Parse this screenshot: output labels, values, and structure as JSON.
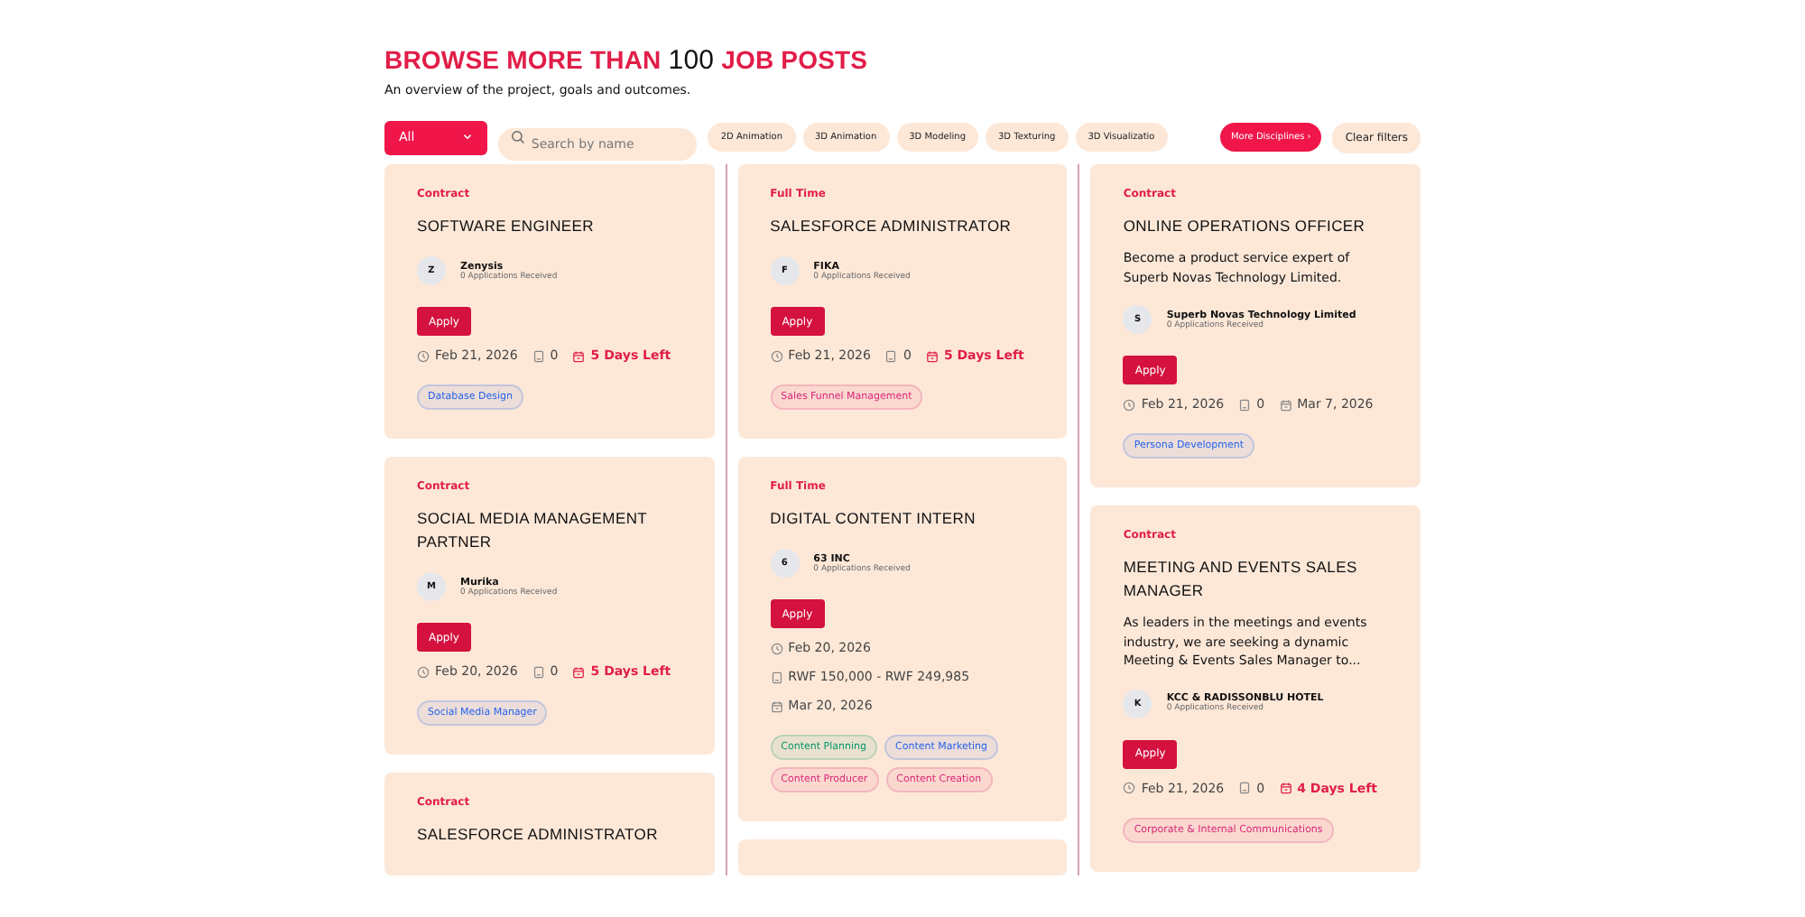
{
  "heading": {
    "lead": "BROWSE MORE THAN",
    "count": "100",
    "tail": "JOB POSTS"
  },
  "subtitle": "An overview of the project, goals and outcomes.",
  "filters": {
    "dropdown": "All",
    "search_placeholder": "Search by name",
    "chips": [
      {
        "label": "2D Animation"
      },
      {
        "label": "3D Animation"
      },
      {
        "label": "3D Modeling"
      },
      {
        "label": "3D Texturing"
      },
      {
        "label": "3D Visualizatio"
      }
    ],
    "more": "More Disciplines",
    "more_icon": "›",
    "clear": "Clear filters"
  },
  "columns": [
    [
      {
        "type": "Contract",
        "title": "SOFTWARE ENGINEER",
        "initial": "Z",
        "company": "Zenysis",
        "applications": "0 Applications Received",
        "apply": "Apply",
        "kind": "inline",
        "posted": "Feb 21, 2026",
        "count": "0",
        "deadline": "5 Days Left",
        "urgent": true,
        "tags": [
          {
            "label": "Database Design",
            "color": "#2563eb"
          }
        ]
      },
      {
        "type": "Contract",
        "title": "SOCIAL MEDIA MANAGEMENT PARTNER",
        "initial": "M",
        "company": "Murika",
        "applications": "0 Applications Received",
        "apply": "Apply",
        "kind": "inline",
        "posted": "Feb 20, 2026",
        "count": "0",
        "deadline": "5 Days Left",
        "urgent": true,
        "tags": [
          {
            "label": "Social Media Manager",
            "color": "#2563eb"
          }
        ]
      },
      {
        "type": "Contract",
        "title": "SALESFORCE ADMINISTRATOR",
        "kind": "cut"
      }
    ],
    [
      {
        "type": "Full Time",
        "title": "SALESFORCE ADMINISTRATOR",
        "initial": "F",
        "company": "FIKA",
        "applications": "0 Applications Received",
        "apply": "Apply",
        "kind": "inline",
        "posted": "Feb 21, 2026",
        "count": "0",
        "deadline": "5 Days Left",
        "urgent": true,
        "tags": [
          {
            "label": "Sales Funnel Management",
            "color": "#db2777"
          }
        ]
      },
      {
        "type": "Full Time",
        "title": "DIGITAL CONTENT INTERN",
        "initial": "6",
        "company": "63 INC",
        "applications": "0 Applications Received",
        "apply": "Apply",
        "kind": "stacked",
        "posted": "Feb 20, 2026",
        "salary": "RWF 150,000 - RWF 249,985",
        "deadline": "Mar 20, 2026",
        "urgent": false,
        "tags": [
          {
            "label": "Content Planning",
            "color": "#059669"
          },
          {
            "label": "Content Marketing",
            "color": "#2563eb"
          },
          {
            "label": "Content Producer",
            "color": "#db2777"
          },
          {
            "label": "Content Creation",
            "color": "#db2777"
          }
        ]
      },
      {
        "kind": "empty"
      }
    ],
    [
      {
        "type": "Contract",
        "title": "ONLINE OPERATIONS OFFICER",
        "description": "Become a product service expert of Superb Novas Technology Limited.",
        "initial": "S",
        "company": "Superb Novas Technology Limited",
        "applications": "0 Applications Received",
        "apply": "Apply",
        "kind": "inline",
        "posted": "Feb 21, 2026",
        "count": "0",
        "deadline": "Mar 7, 2026",
        "urgent": false,
        "tags": [
          {
            "label": "Persona Development",
            "color": "#2563eb"
          }
        ]
      },
      {
        "type": "Contract",
        "title": "MEETING AND EVENTS SALES MANAGER",
        "description": "As leaders in the meetings and events industry, we are seeking a dynamic Meeting & Events Sales Manager to...",
        "initial": "K",
        "company": "KCC & RADISSONBLU HOTEL",
        "applications": "0 Applications Received",
        "apply": "Apply",
        "kind": "inline",
        "posted": "Feb 21, 2026",
        "count": "0",
        "deadline": "4 Days Left",
        "urgent": true,
        "tags": [
          {
            "label": "Corporate & Internal Communications",
            "color": "#db2777"
          }
        ]
      }
    ]
  ]
}
